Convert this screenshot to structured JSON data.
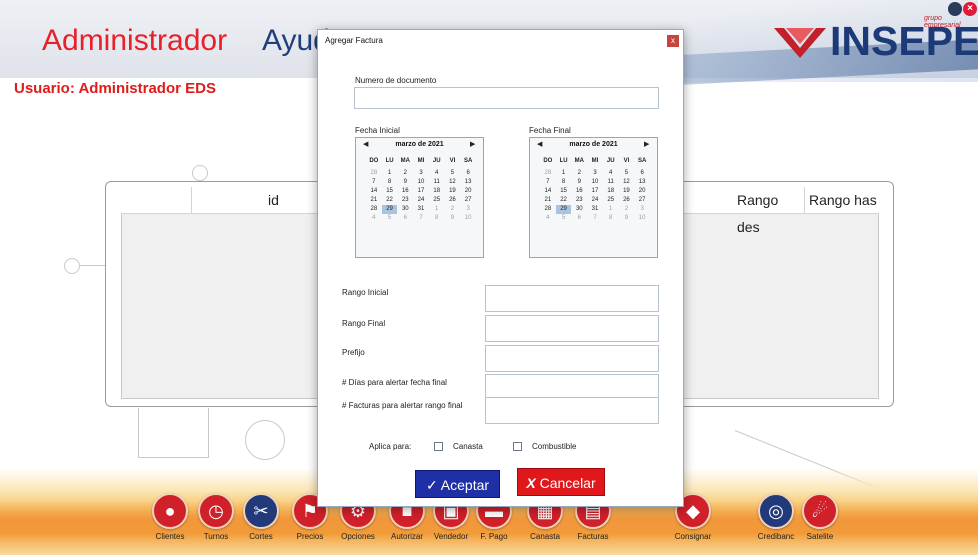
{
  "app": {
    "title": "Administrador",
    "title2": "Ayud",
    "user_label": "Usuario: Administrador EDS",
    "brand": "INSEPET",
    "brand_tag": "grupo empresarial",
    "colors": {
      "accent_red": "#e01b1b",
      "brand_blue": "#1d3a78"
    }
  },
  "grid": {
    "columns": [
      "id",
      "Rango des",
      "Rango has"
    ]
  },
  "dock": [
    {
      "label": "Clientes",
      "icon": "clients-icon"
    },
    {
      "label": "Turnos",
      "icon": "clock-icon"
    },
    {
      "label": "Cortes",
      "icon": "scissors-icon"
    },
    {
      "label": "Precios",
      "icon": "tag-icon"
    },
    {
      "label": "Opciones",
      "icon": "gear-icon"
    },
    {
      "label": "Autorizar",
      "icon": "authorize-icon"
    },
    {
      "label": "Vendedor",
      "icon": "seller-icon"
    },
    {
      "label": "F. Pago",
      "icon": "payment-icon"
    },
    {
      "label": "Canasta",
      "icon": "basket-icon"
    },
    {
      "label": "Facturas",
      "icon": "invoice-icon"
    },
    {
      "label": "Consignar",
      "icon": "deposit-icon"
    },
    {
      "label": "Credibanc",
      "icon": "credibanc-icon"
    },
    {
      "label": "Satelite",
      "icon": "satellite-icon"
    }
  ],
  "modal": {
    "title": "Agregar Factura",
    "close": "x",
    "doc_number_label": "Numero de documento",
    "doc_number_value": "",
    "fecha_inicial_label": "Fecha Inicial",
    "fecha_final_label": "Fecha Final",
    "calendar": {
      "month": "marzo de 2021",
      "prev": "◀",
      "next": "▶",
      "weekdays": [
        "DO",
        "LU",
        "MA",
        "MI",
        "JU",
        "VI",
        "SA"
      ],
      "weeks": [
        [
          "28",
          "1",
          "2",
          "3",
          "4",
          "5",
          "6"
        ],
        [
          "7",
          "8",
          "9",
          "10",
          "11",
          "12",
          "13"
        ],
        [
          "14",
          "15",
          "16",
          "17",
          "18",
          "19",
          "20"
        ],
        [
          "21",
          "22",
          "23",
          "24",
          "25",
          "26",
          "27"
        ],
        [
          "28",
          "29",
          "30",
          "31",
          "1",
          "2",
          "3"
        ],
        [
          "4",
          "5",
          "6",
          "7",
          "8",
          "9",
          "10"
        ]
      ],
      "selected_day": "29"
    },
    "rango_inicial_label": "Rango Inicial",
    "rango_final_label": "Rango Final",
    "prefijo_label": "Prefijo",
    "dias_alerta_label": "# Días para alertar fecha final",
    "facturas_alerta_label": "# Facturas para alertar rango final",
    "aplica_label": "Aplica para:",
    "canasta_label": "Canasta",
    "combustible_label": "Combustible",
    "accept_label": "Aceptar",
    "accept_icon": "✓",
    "cancel_label": "Cancelar",
    "cancel_icon": "X"
  }
}
